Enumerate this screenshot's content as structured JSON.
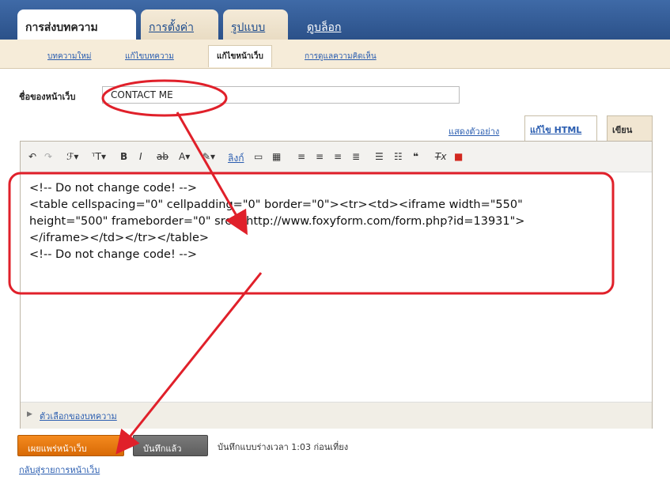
{
  "topnav": {
    "tabs": [
      "การส่งบทความ",
      "การตั้งค่า",
      "รูปแบบ",
      "ดูบล็อก"
    ]
  },
  "subnav": {
    "items": [
      "บทความใหม่",
      "แก้ไขบทความ",
      "แก้ไขหน้าเว็บ",
      "การดูแลความคิดเห็น"
    ]
  },
  "form": {
    "title_label": "ชื่อของหน้าเว็บ",
    "title_value": "CONTACT ME"
  },
  "editor": {
    "preview_link": "แสดงตัวอย่าง",
    "edit_html_tab": "แก้ไข HTML",
    "compose_tab": "เขียน",
    "toolbar": {
      "link_label": "ลิงก์"
    },
    "code_lines": [
      "<!-- Do not change code! -->",
      "<table cellspacing=\"0\" cellpadding=\"0\" border=\"0\"><tr><td><iframe width=\"550\"",
      "height=\"500\" frameborder=\"0\" src=\"http://www.foxyform.com/form.php?id=13931\">",
      "</iframe></td></tr></table>",
      "<!-- Do not change code! -->"
    ],
    "options_label": "ตัวเลือกของบทความ"
  },
  "actions": {
    "publish_label": "เผยแพร่หน้าเว็บ",
    "saved_label": "บันทึกแล้ว",
    "status_text": "บันทึกแบบร่างเวลา 1:03 ก่อนเที่ยง",
    "back_link": "กลับสู่รายการหน้าเว็บ"
  },
  "colors": {
    "annotation": "#e0202a",
    "publish": "#f07d16"
  }
}
